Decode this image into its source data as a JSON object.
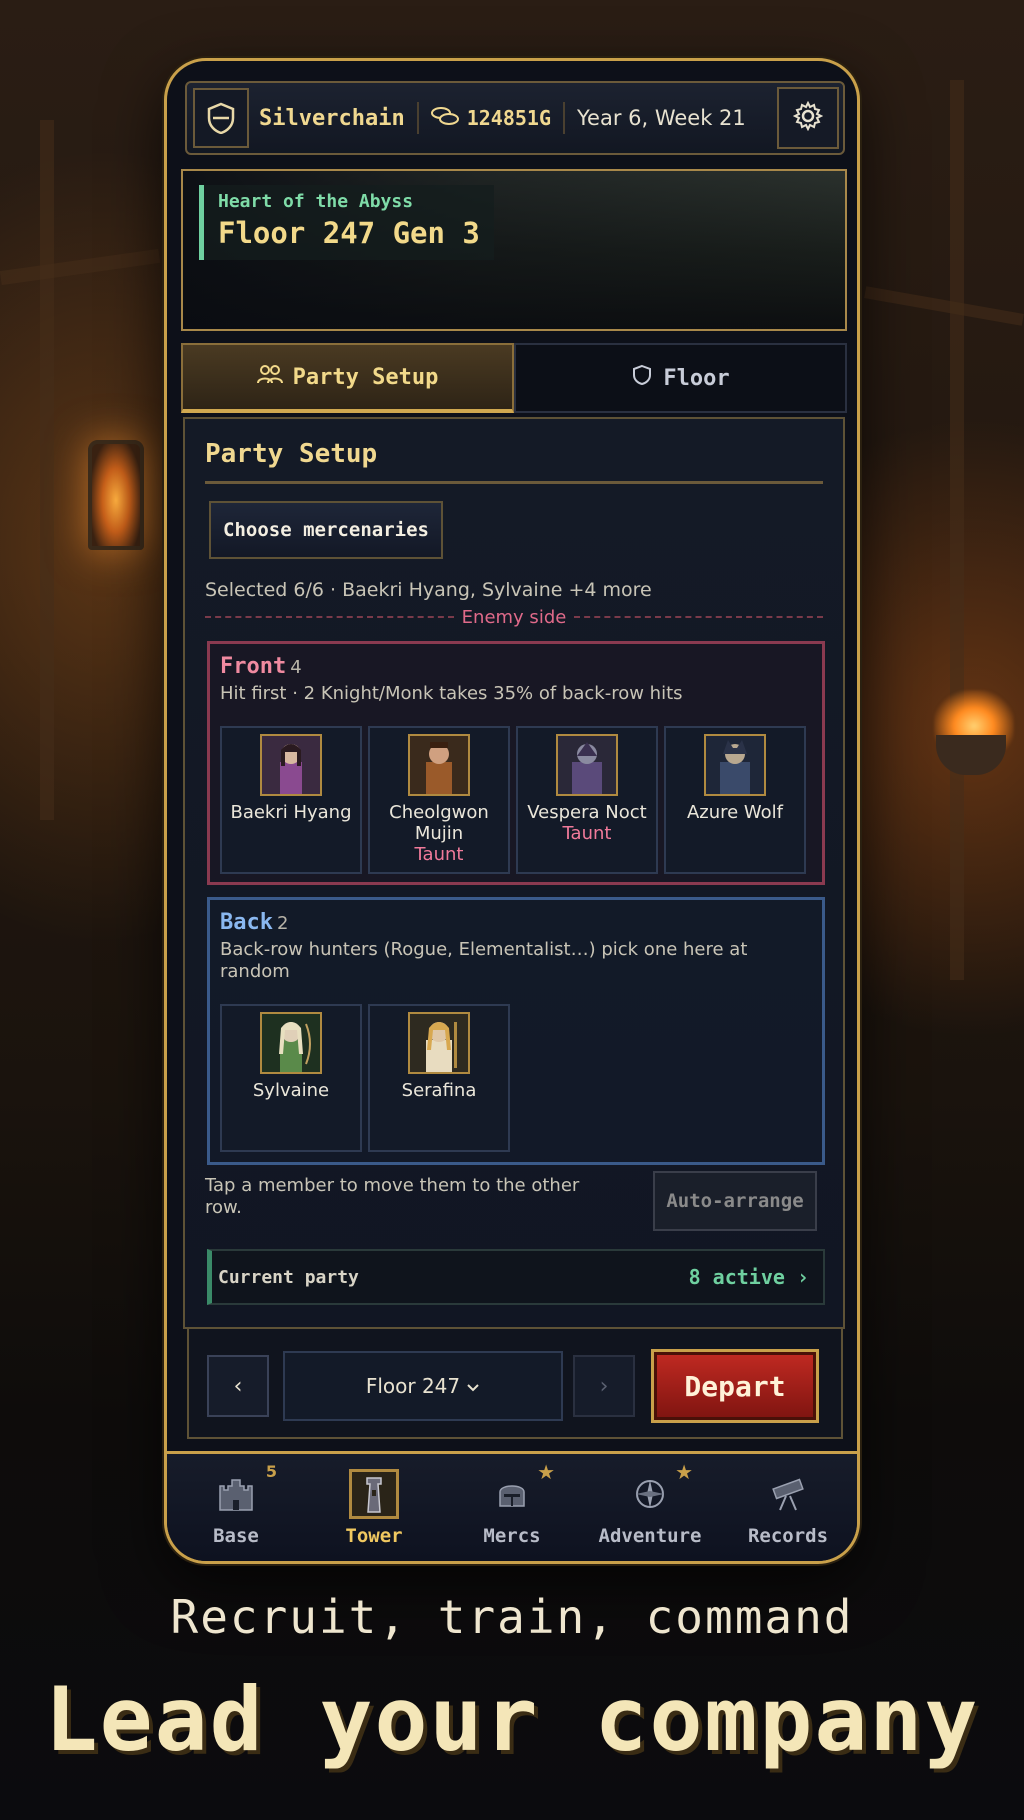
{
  "header": {
    "guild_name": "Silverchain",
    "gold": "124851G",
    "date": "Year 6, Week 21",
    "icons": {
      "guild": "shield-icon",
      "gold": "coins-icon",
      "settings": "gear-icon"
    }
  },
  "banner": {
    "dungeon_name": "Heart of the Abyss",
    "floor_title": "Floor 247 Gen 3"
  },
  "tabs": [
    {
      "label": "Party Setup",
      "icon": "party-icon",
      "active": true
    },
    {
      "label": "Floor",
      "icon": "shield-icon",
      "active": false
    }
  ],
  "panel": {
    "title": "Party Setup",
    "choose_button": "Choose mercenaries",
    "selected_text": "Selected 6/6 · Baekri Hyang, Sylvaine +4 more",
    "enemy_side": "Enemy side",
    "front": {
      "label": "Front",
      "count": "4",
      "description": "Hit first · 2 Knight/Monk takes 35% of back-row hits",
      "members": [
        {
          "name": "Baekri Hyang",
          "tag": "",
          "color": "#8a4a90"
        },
        {
          "name": "Cheolgwon Mujin",
          "tag": "Taunt",
          "color": "#9a5a2a"
        },
        {
          "name": "Vespera Noct",
          "tag": "Taunt",
          "color": "#5a4a7a"
        },
        {
          "name": "Azure Wolf",
          "tag": "",
          "color": "#3a4a6a"
        }
      ]
    },
    "back": {
      "label": "Back",
      "count": "2",
      "description": "Back-row hunters (Rogue, Elementalist…) pick one here at random",
      "members": [
        {
          "name": "Sylvaine",
          "tag": "",
          "color": "#5a8a4a"
        },
        {
          "name": "Serafina",
          "tag": "",
          "color": "#b08a4a"
        }
      ]
    },
    "tap_hint": "Tap a member to move them to the other row.",
    "auto_arrange": "Auto-arrange",
    "current_party_label": "Current party",
    "current_party_value": "8 active ›"
  },
  "floor_selector": {
    "prev": "‹",
    "next": "›",
    "floor": "Floor 247",
    "depart": "Depart"
  },
  "bottom_nav": [
    {
      "label": "Base",
      "icon": "castle-icon",
      "badge": "5",
      "star": false,
      "active": false
    },
    {
      "label": "Tower",
      "icon": "tower-icon",
      "badge": "",
      "star": false,
      "active": true
    },
    {
      "label": "Mercs",
      "icon": "helmet-icon",
      "badge": "",
      "star": true,
      "active": false
    },
    {
      "label": "Adventure",
      "icon": "compass-icon",
      "badge": "",
      "star": true,
      "active": false
    },
    {
      "label": "Records",
      "icon": "telescope-icon",
      "badge": "",
      "star": false,
      "active": false
    }
  ],
  "marketing": {
    "tagline": "Recruit, train, command",
    "headline": "Lead your company"
  }
}
